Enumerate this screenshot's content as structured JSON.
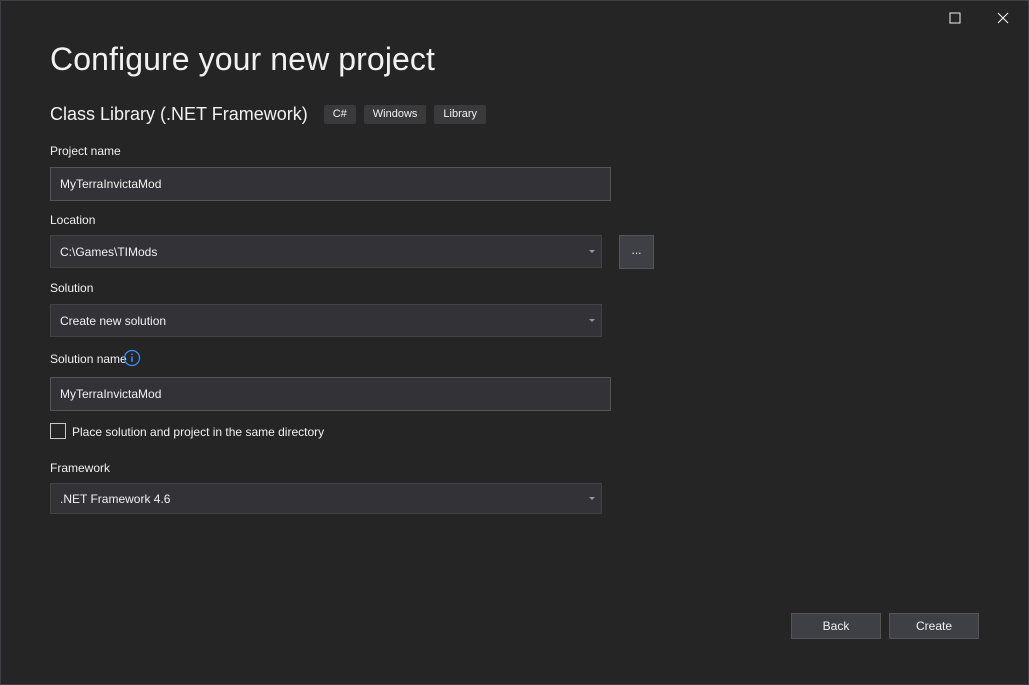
{
  "header": {
    "title": "Configure your new project",
    "template_name": "Class Library (.NET Framework)",
    "tags": [
      "C#",
      "Windows",
      "Library"
    ]
  },
  "form": {
    "project_name": {
      "label": "Project name",
      "value": "MyTerraInvictaMod"
    },
    "location": {
      "label": "Location",
      "value": "C:\\Games\\TIMods",
      "browse_label": "..."
    },
    "solution": {
      "label": "Solution",
      "value": "Create new solution"
    },
    "solution_name": {
      "label": "Solution name",
      "value": "MyTerraInvictaMod"
    },
    "same_directory": {
      "label": "Place solution and project in the same directory",
      "checked": false
    },
    "framework": {
      "label": "Framework",
      "value": ".NET Framework 4.6"
    }
  },
  "footer": {
    "back_label": "Back",
    "create_label": "Create"
  },
  "icons": {
    "maximize": "maximize-icon",
    "close": "close-icon",
    "info": "info-icon",
    "dropdown": "chevron-down-icon"
  },
  "colors": {
    "background": "#252526",
    "field_background": "#333337",
    "button_background": "#3f3f46",
    "info_accent": "#3794ff",
    "text": "#f1f1f1"
  }
}
